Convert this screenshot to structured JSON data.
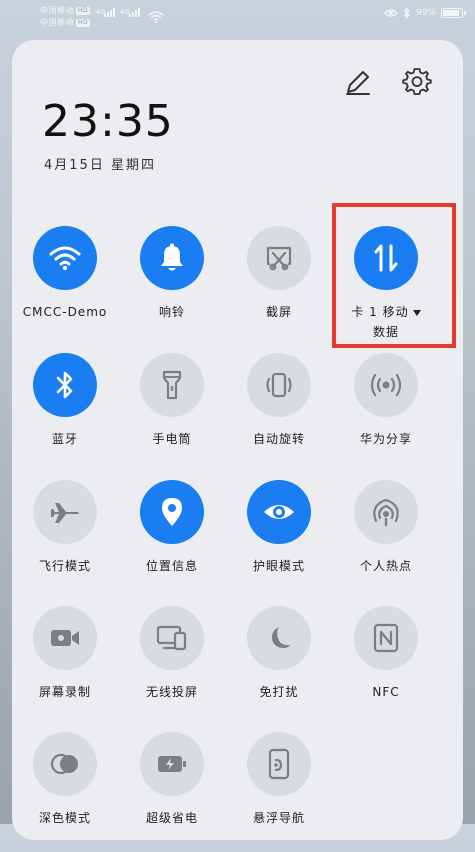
{
  "status_bar": {
    "carrier_1": "中国移动",
    "carrier_2": "中国移动",
    "hd_badge": "HD",
    "net_1": "4G",
    "net_2": "4G",
    "battery_text": "99%",
    "battery_level": 0.99
  },
  "panel": {
    "time": "23:35",
    "date": "4月15日 星期四"
  },
  "tiles": [
    {
      "label": "CMCC-Demo",
      "on": true
    },
    {
      "label": "响铃",
      "on": true
    },
    {
      "label": "截屏",
      "on": false
    },
    {
      "label_line1": "卡 1 移动",
      "label_line2": "数据",
      "on": true
    },
    {
      "label": "蓝牙",
      "on": true
    },
    {
      "label": "手电筒",
      "on": false
    },
    {
      "label": "自动旋转",
      "on": false
    },
    {
      "label": "华为分享",
      "on": false
    },
    {
      "label": "飞行模式",
      "on": false
    },
    {
      "label": "位置信息",
      "on": true
    },
    {
      "label": "护眼模式",
      "on": true
    },
    {
      "label": "个人热点",
      "on": false
    },
    {
      "label": "屏幕录制",
      "on": false
    },
    {
      "label": "无线投屏",
      "on": false
    },
    {
      "label": "免打扰",
      "on": false
    },
    {
      "label": "NFC",
      "on": false
    },
    {
      "label": "深色模式",
      "on": false
    },
    {
      "label": "超级省电",
      "on": false
    },
    {
      "label": "悬浮导航",
      "on": false
    }
  ],
  "colors": {
    "accent": "#1a7ef2",
    "tile_off": "#d8dbdf",
    "icon_off": "#7a7f86",
    "highlight": "#e53a2e"
  }
}
